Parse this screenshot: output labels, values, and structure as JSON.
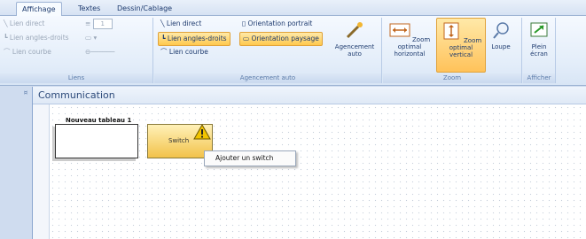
{
  "tabs": [
    "Affichage",
    "Textes",
    "Dessin/Cablage"
  ],
  "ribbon": {
    "liens": {
      "label": "Liens",
      "lien_direct": "Lien direct",
      "lien_angles": "Lien angles-droits",
      "lien_courbe": "Lien courbe",
      "spin_value": "1"
    },
    "agencement": {
      "label": "Agencement auto",
      "lien_direct": "Lien direct",
      "lien_angles": "Lien angles-droits",
      "lien_courbe": "Lien courbe",
      "orientation_portrait": "Orientation portrait",
      "orientation_paysage": "Orientation paysage",
      "agencement_auto": "Agencement auto"
    },
    "zoom": {
      "label": "Zoom",
      "horizontal": "Zoom optimal horizontal",
      "vertical": "Zoom optimal vertical",
      "loupe": "Loupe"
    },
    "afficher": {
      "label": "Afficher",
      "plein_ecran": "Plein écran"
    }
  },
  "document": {
    "title": "Communication",
    "table_title": "Nouveau tableau 1",
    "switch_label": "Switch",
    "context_menu_item": "Ajouter un switch"
  },
  "colors": {
    "accent_selected": "#ffc94d",
    "ribbon_bg": "#e3edf9",
    "warning": "#f2c400"
  }
}
